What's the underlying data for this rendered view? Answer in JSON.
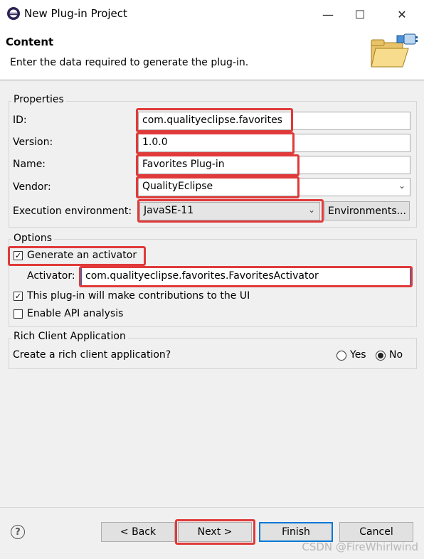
{
  "window": {
    "title": "New Plug-in Project",
    "icon": "eclipse-icon",
    "minimize": "—",
    "maximize": "☐",
    "close": "✕"
  },
  "header": {
    "title": "Content",
    "description": "Enter the data required to generate the plug-in.",
    "icon": "folder-plug-icon"
  },
  "properties": {
    "group_label": "Properties",
    "id_label": "ID:",
    "id_value": "com.qualityeclipse.favorites",
    "version_label": "Version:",
    "version_value": "1.0.0",
    "name_label": "Name:",
    "name_value": "Favorites Plug-in",
    "vendor_label": "Vendor:",
    "vendor_value": "QualityEclipse",
    "exec_env_label": "Execution environment:",
    "exec_env_value": "JavaSE-11",
    "environments_button": "Environments..."
  },
  "options": {
    "group_label": "Options",
    "generate_activator_label": "Generate an activator",
    "generate_activator_checked": true,
    "activator_label": "Activator:",
    "activator_value": "com.qualityeclipse.favorites.FavoritesActivator",
    "ui_contrib_label": "This plug-in will make contributions to the UI",
    "ui_contrib_checked": true,
    "api_analysis_label": "Enable API analysis",
    "api_analysis_checked": false
  },
  "rcp": {
    "group_label": "Rich Client Application",
    "question": "Create a rich client application?",
    "yes_label": "Yes",
    "no_label": "No",
    "selected": "No"
  },
  "footer": {
    "help_icon": "?",
    "back_button": "< Back",
    "next_button": "Next >",
    "finish_button": "Finish",
    "cancel_button": "Cancel"
  },
  "watermark": "CSDN @FireWhirlwind",
  "colors": {
    "highlight": "#e03a3a",
    "focus_border": "#0078d7"
  }
}
